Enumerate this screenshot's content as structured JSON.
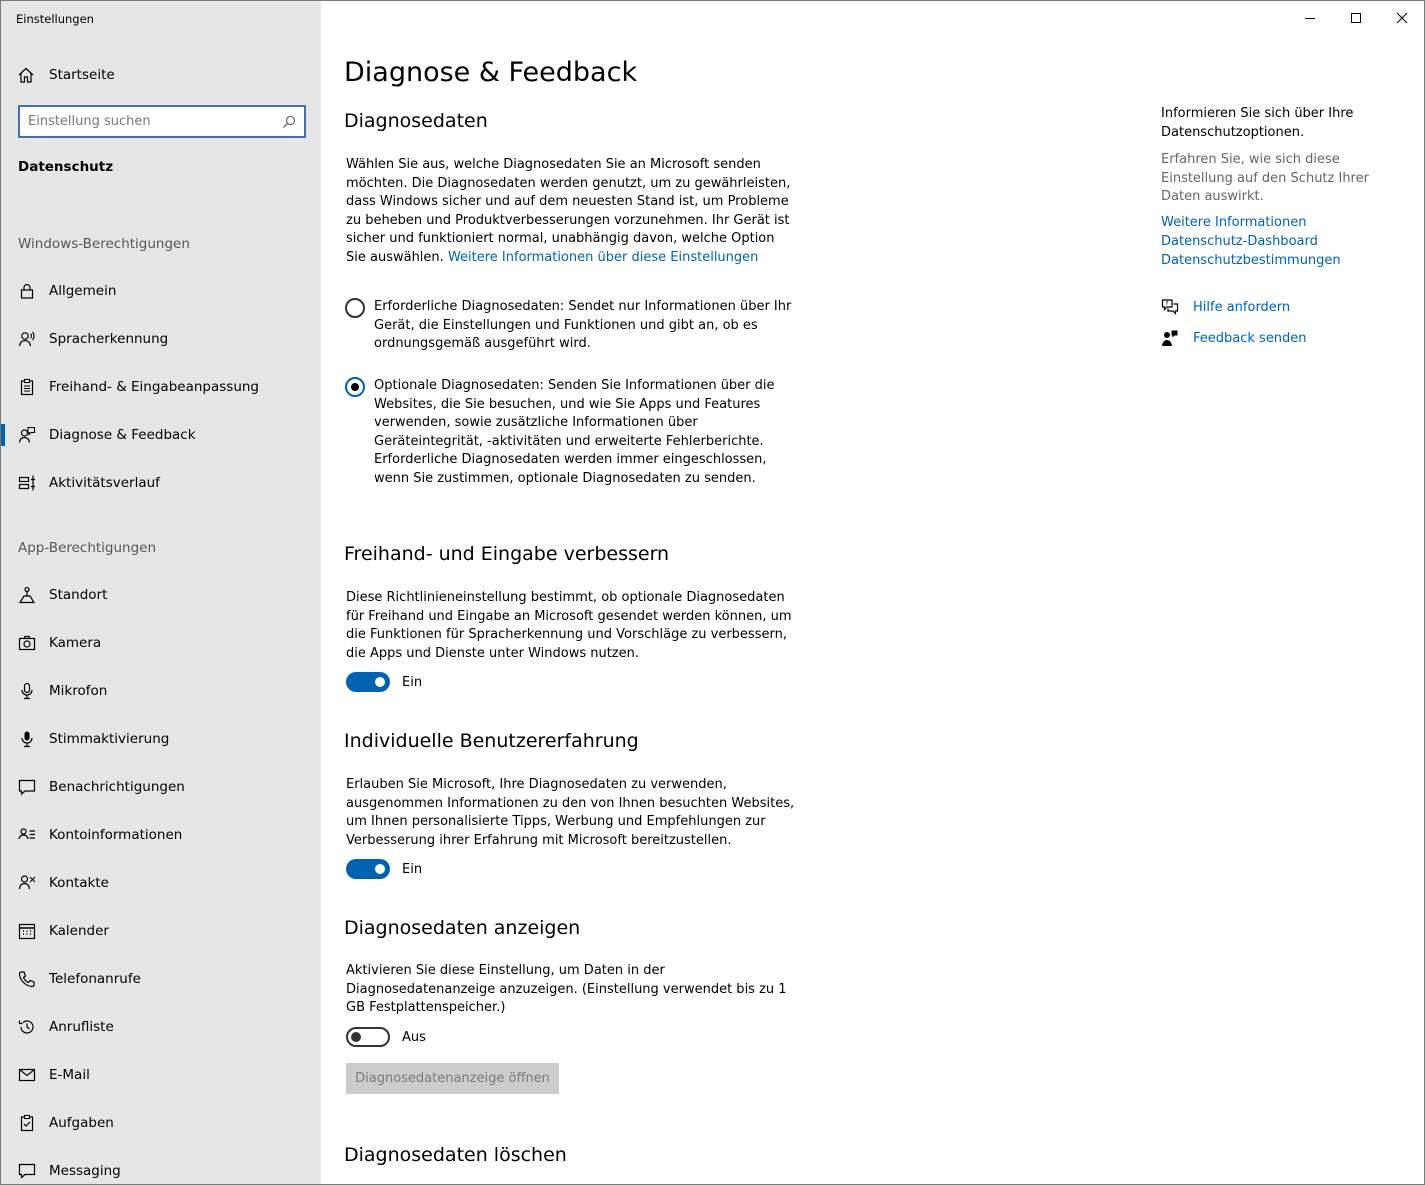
{
  "window": {
    "title": "Einstellungen"
  },
  "sidebar": {
    "home_label": "Startseite",
    "search_placeholder": "Einstellung suchen",
    "current_section": "Datenschutz",
    "windows_group_label": "Windows-Berechtigungen",
    "windows_items": [
      {
        "label": "Allgemein",
        "icon": "lock-icon"
      },
      {
        "label": "Spracherkennung",
        "icon": "speech-icon"
      },
      {
        "label": "Freihand- & Eingabeanpassung",
        "icon": "clipboard-icon"
      },
      {
        "label": "Diagnose & Feedback",
        "icon": "feedback-person-icon",
        "active": true
      },
      {
        "label": "Aktivitätsverlauf",
        "icon": "timeline-icon"
      }
    ],
    "app_group_label": "App-Berechtigungen",
    "app_items": [
      {
        "label": "Standort",
        "icon": "location-icon"
      },
      {
        "label": "Kamera",
        "icon": "camera-icon"
      },
      {
        "label": "Mikrofon",
        "icon": "microphone-icon"
      },
      {
        "label": "Stimmaktivierung",
        "icon": "voice-activation-icon"
      },
      {
        "label": "Benachrichtigungen",
        "icon": "notification-icon"
      },
      {
        "label": "Kontoinformationen",
        "icon": "account-info-icon"
      },
      {
        "label": "Kontakte",
        "icon": "contacts-icon"
      },
      {
        "label": "Kalender",
        "icon": "calendar-icon"
      },
      {
        "label": "Telefonanrufe",
        "icon": "phone-icon"
      },
      {
        "label": "Anrufliste",
        "icon": "call-history-icon"
      },
      {
        "label": "E-Mail",
        "icon": "mail-icon"
      },
      {
        "label": "Aufgaben",
        "icon": "tasks-icon"
      },
      {
        "label": "Messaging",
        "icon": "messaging-icon"
      }
    ]
  },
  "main": {
    "page_title": "Diagnose & Feedback",
    "diagnostic": {
      "heading": "Diagnosedaten",
      "description": "Wählen Sie aus, welche Diagnosedaten Sie an Microsoft senden möchten. Die Diagnosedaten werden genutzt, um zu gewährleisten, dass Windows sicher und auf dem neuesten Stand ist, um Probleme zu beheben und Produktverbesserungen vorzunehmen. Ihr Gerät ist sicher und funktioniert normal, unabhängig davon, welche Option Sie auswählen.",
      "link": "Weitere Informationen über diese Einstellungen",
      "option_required": "Erforderliche Diagnosedaten: Sendet nur Informationen über Ihr Gerät, die Einstellungen und Funktionen und gibt an, ob es ordnungsgemäß ausgeführt wird.",
      "option_optional": "Optionale Diagnosedaten: Senden Sie Informationen über die Websites, die Sie besuchen, und wie Sie Apps und Features verwenden, sowie zusätzliche Informationen über Geräteintegrität, -aktivitäten und erweiterte Fehlerberichte. Erforderliche Diagnosedaten werden immer eingeschlossen, wenn Sie zustimmen, optionale Diagnosedaten zu senden.",
      "selected": "optional"
    },
    "inking": {
      "heading": "Freihand- und Eingabe verbessern",
      "description": "Diese Richtlinieneinstellung bestimmt, ob optionale Diagnosedaten für Freihand und Eingabe an Microsoft gesendet werden können, um die Funktionen für Spracherkennung und Vorschläge zu verbessern, die Apps und Dienste unter Windows nutzen.",
      "toggle_state": "Ein"
    },
    "tailored": {
      "heading": "Individuelle Benutzererfahrung",
      "description": "Erlauben Sie Microsoft, Ihre Diagnosedaten zu verwenden, ausgenommen Informationen zu den von Ihnen besuchten Websites, um Ihnen personalisierte Tipps, Werbung und Empfehlungen zur Verbesserung ihrer Erfahrung mit Microsoft bereitzustellen.",
      "toggle_state": "Ein"
    },
    "viewer": {
      "heading": "Diagnosedaten anzeigen",
      "description": "Aktivieren Sie diese Einstellung, um Daten in der Diagnosedatenanzeige anzuzeigen. (Einstellung verwendet bis zu 1 GB Festplattenspeicher.)",
      "toggle_state": "Aus",
      "open_button": "Diagnosedatenanzeige öffnen"
    },
    "delete": {
      "heading": "Diagnosedaten löschen"
    }
  },
  "right_panel": {
    "title": "Informieren Sie sich über Ihre Datenschutzoptionen.",
    "description": "Erfahren Sie, wie sich diese Einstellung auf den Schutz Ihrer Daten auswirkt.",
    "links": [
      "Weitere Informationen",
      "Datenschutz-Dashboard",
      "Datenschutzbestimmungen"
    ],
    "help_label": "Hilfe anfordern",
    "feedback_label": "Feedback senden"
  },
  "colors": {
    "accent": "#0063b1",
    "sidebar_bg": "#e6e6e6"
  }
}
